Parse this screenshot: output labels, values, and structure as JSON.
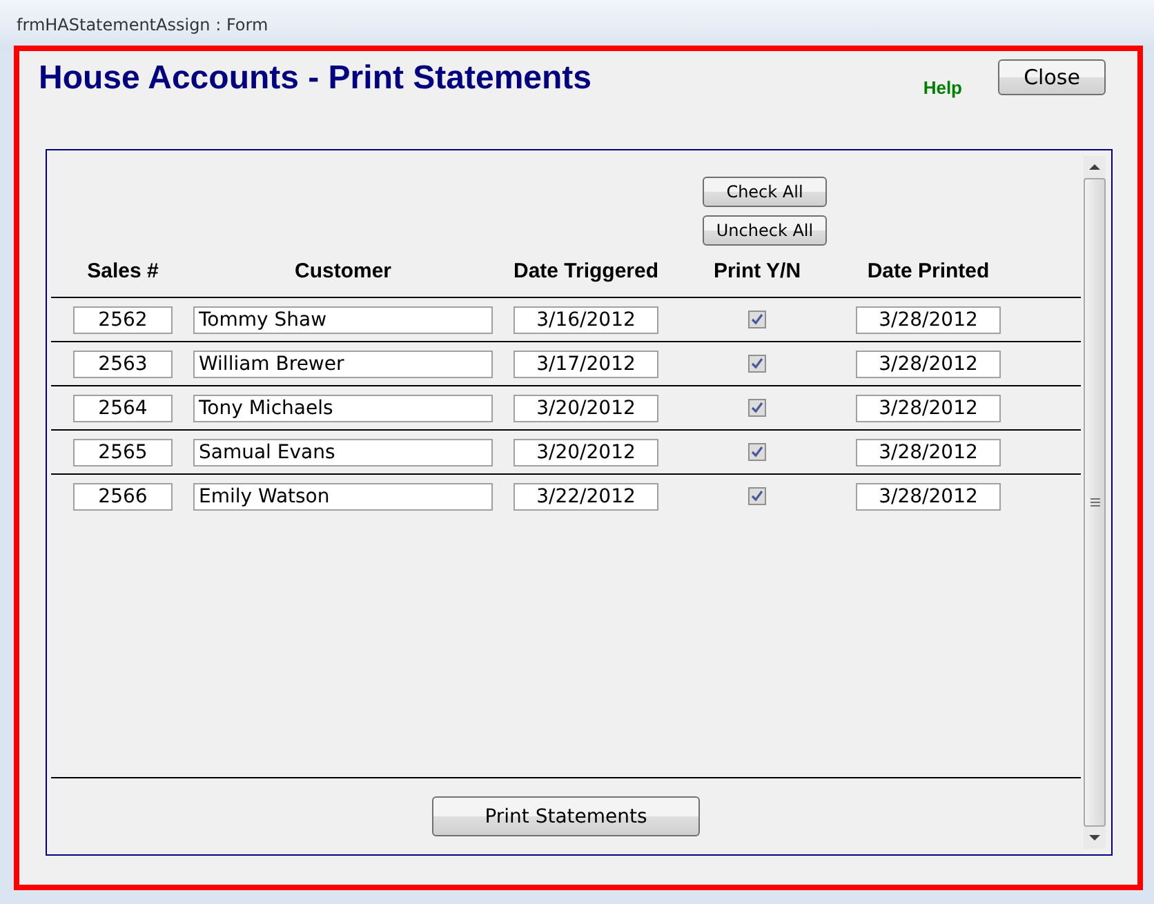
{
  "window": {
    "title": "frmHAStatementAssign : Form"
  },
  "heading": "House Accounts - Print Statements",
  "help_link": "Help",
  "close_button": "Close",
  "check_all_button": "Check All",
  "uncheck_all_button": "Uncheck All",
  "columns": [
    "Sales #",
    "Customer",
    "Date Triggered",
    "Print Y/N",
    "Date Printed"
  ],
  "rows": [
    {
      "sales": "2562",
      "customer": "Tommy Shaw",
      "date_triggered": "3/16/2012",
      "print": true,
      "date_printed": "3/28/2012"
    },
    {
      "sales": "2563",
      "customer": "William Brewer",
      "date_triggered": "3/17/2012",
      "print": true,
      "date_printed": "3/28/2012"
    },
    {
      "sales": "2564",
      "customer": "Tony Michaels",
      "date_triggered": "3/20/2012",
      "print": true,
      "date_printed": "3/28/2012"
    },
    {
      "sales": "2565",
      "customer": "Samual Evans",
      "date_triggered": "3/20/2012",
      "print": true,
      "date_printed": "3/28/2012"
    },
    {
      "sales": "2566",
      "customer": "Emily Watson",
      "date_triggered": "3/22/2012",
      "print": true,
      "date_printed": "3/28/2012"
    }
  ],
  "print_button": "Print Statements"
}
